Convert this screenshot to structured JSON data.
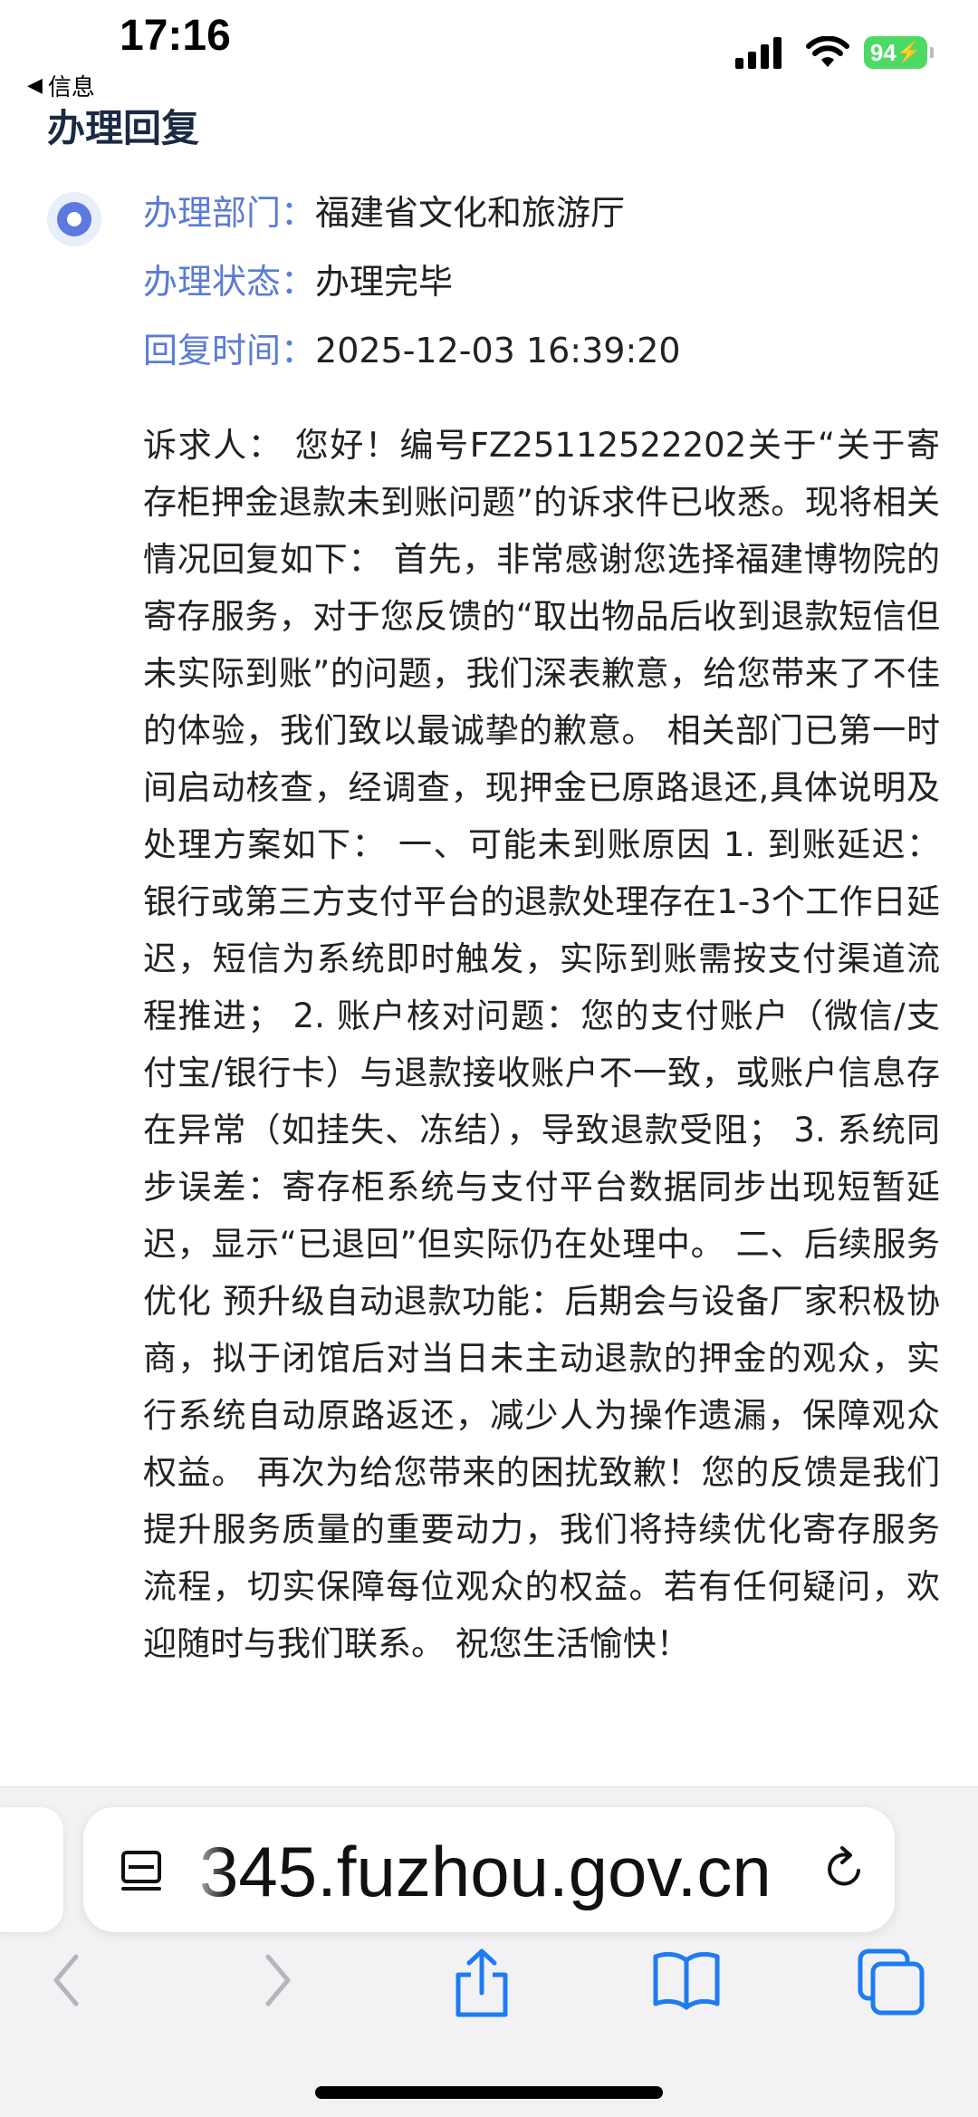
{
  "status_bar": {
    "time": "17:16",
    "back_app": "信息",
    "battery": "94"
  },
  "page": {
    "title": "办理回复",
    "department_label": "办理部门：",
    "department_value": "福建省文化和旅游厅",
    "status_label": "办理状态：",
    "status_value": "办理完毕",
    "reply_time_label": "回复时间：",
    "reply_time_value": "2025-12-03 16:39:20",
    "reply_content": "诉求人： 您好！编号FZ25112522202关于“关于寄存柜押金退款未到账问题”的诉求件已收悉。现将相关情况回复如下： 首先，非常感谢您选择福建博物院的寄存服务，对于您反馈的“取出物品后收到退款短信但未实际到账”的问题，我们深表歉意，给您带来了不佳的体验，我们致以最诚挚的歉意。 相关部门已第一时间启动核查，经调查，现押金已原路退还,具体说明及处理方案如下： 一、可能未到账原因 1. 到账延迟：银行或第三方支付平台的退款处理存在1-3个工作日延迟，短信为系统即时触发，实际到账需按支付渠道流程推进； 2. 账户核对问题：您的支付账户（微信/支付宝/银行卡）与退款接收账户不一致，或账户信息存在异常（如挂失、冻结），导致退款受阻； 3. 系统同步误差：寄存柜系统与支付平台数据同步出现短暂延迟，显示“已退回”但实际仍在处理中。 二、后续服务优化 预升级自动退款功能：后期会与设备厂家积极协商，拟于闭馆后对当日未主动退款的押金的观众，实行系统自动原路返还，减少人为操作遗漏，保障观众权益。 再次为给您带来的困扰致歉！您的反馈是我们提升服务质量的重要动力，我们将持续优化寄存服务流程，切实保障每位观众的权益。若有任何疑问，欢迎随时与我们联系。 祝您生活愉快！"
  },
  "browser": {
    "address": "345.fuzhou.gov.cn",
    "icons": {
      "reader": "reader-icon",
      "reload": "reload-icon",
      "back": "chevron-left-icon",
      "forward": "chevron-right-icon",
      "share": "share-icon",
      "bookmarks": "book-icon",
      "tabs": "tabs-icon"
    },
    "accent_color": "#1e7cf2",
    "disabled_color": "#b5b5ba"
  },
  "colors": {
    "label": "#5a7bd6",
    "title": "#1b2a44",
    "battery": "#4cd964"
  }
}
